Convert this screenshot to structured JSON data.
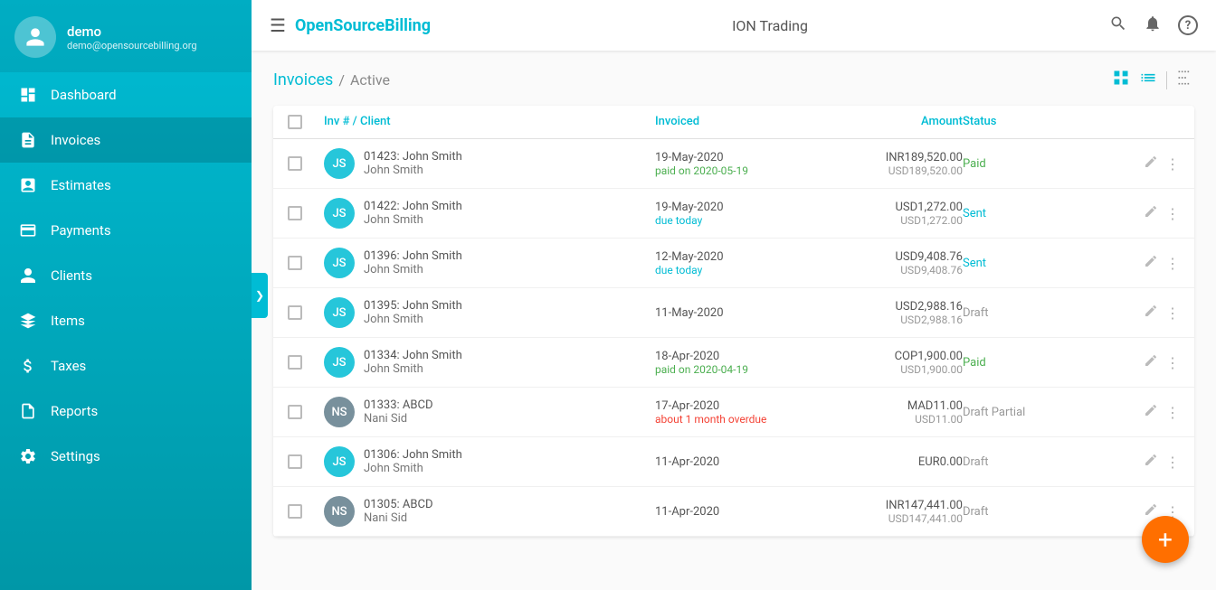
{
  "app": {
    "title": "ION Trading",
    "logo_prefix": "OpenSource",
    "logo_suffix": "Billing"
  },
  "topbar": {
    "hamburger_label": "☰",
    "search_label": "🔍",
    "bell_label": "🔔",
    "help_label": "?"
  },
  "sidebar": {
    "user": {
      "name": "demo",
      "email": "demo@opensourcebilling.org",
      "avatar_label": "👤"
    },
    "nav_items": [
      {
        "id": "dashboard",
        "label": "Dashboard",
        "icon": "⊞"
      },
      {
        "id": "invoices",
        "label": "Invoices",
        "icon": "≡",
        "active": true
      },
      {
        "id": "estimates",
        "label": "Estimates",
        "icon": "⊟"
      },
      {
        "id": "payments",
        "label": "Payments",
        "icon": "💲"
      },
      {
        "id": "clients",
        "label": "Clients",
        "icon": "👤"
      },
      {
        "id": "items",
        "label": "Items",
        "icon": "◈"
      },
      {
        "id": "taxes",
        "label": "Taxes",
        "icon": "＄"
      },
      {
        "id": "reports",
        "label": "Reports",
        "icon": "📄"
      },
      {
        "id": "settings",
        "label": "Settings",
        "icon": "⚙"
      }
    ]
  },
  "page": {
    "title": "Invoices",
    "breadcrumb": "Active"
  },
  "table": {
    "columns": [
      {
        "id": "checkbox",
        "label": ""
      },
      {
        "id": "inv_client",
        "label": "Inv # / Client"
      },
      {
        "id": "invoiced",
        "label": "Invoiced"
      },
      {
        "id": "amount",
        "label": "Amount"
      },
      {
        "id": "status",
        "label": "Status"
      },
      {
        "id": "actions",
        "label": ""
      }
    ],
    "rows": [
      {
        "avatar_initials": "JS",
        "avatar_class": "avatar-js",
        "inv_number": "01423: John Smith",
        "client_name": "John Smith",
        "date_primary": "19-May-2020",
        "date_secondary": "paid on 2020-05-19",
        "date_secondary_class": "text-green",
        "amount_primary": "INR189,520.00",
        "amount_secondary": "USD189,520.00",
        "status": "Paid",
        "status_class": "status-paid"
      },
      {
        "avatar_initials": "JS",
        "avatar_class": "avatar-js",
        "inv_number": "01422: John Smith",
        "client_name": "John Smith",
        "date_primary": "19-May-2020",
        "date_secondary": "due today",
        "date_secondary_class": "text-cyan",
        "amount_primary": "USD1,272.00",
        "amount_secondary": "USD1,272.00",
        "status": "Sent",
        "status_class": "status-sent"
      },
      {
        "avatar_initials": "JS",
        "avatar_class": "avatar-js",
        "inv_number": "01396: John Smith",
        "client_name": "John Smith",
        "date_primary": "12-May-2020",
        "date_secondary": "due today",
        "date_secondary_class": "text-cyan",
        "amount_primary": "USD9,408.76",
        "amount_secondary": "USD9,408.76",
        "status": "Sent",
        "status_class": "status-sent"
      },
      {
        "avatar_initials": "JS",
        "avatar_class": "avatar-js",
        "inv_number": "01395: John Smith",
        "client_name": "John Smith",
        "date_primary": "11-May-2020",
        "date_secondary": "",
        "date_secondary_class": "",
        "amount_primary": "USD2,988.16",
        "amount_secondary": "USD2,988.16",
        "status": "Draft",
        "status_class": "status-draft"
      },
      {
        "avatar_initials": "JS",
        "avatar_class": "avatar-js",
        "inv_number": "01334: John Smith",
        "client_name": "John Smith",
        "date_primary": "18-Apr-2020",
        "date_secondary": "paid on 2020-04-19",
        "date_secondary_class": "text-green",
        "amount_primary": "COP1,900.00",
        "amount_secondary": "USD1,900.00",
        "status": "Paid",
        "status_class": "status-paid"
      },
      {
        "avatar_initials": "NS",
        "avatar_class": "avatar-ns",
        "inv_number": "01333: ABCD",
        "client_name": "Nani Sid",
        "date_primary": "17-Apr-2020",
        "date_secondary": "about 1 month overdue",
        "date_secondary_class": "text-red",
        "amount_primary": "MAD11.00",
        "amount_secondary": "USD11.00",
        "status": "Draft Partial",
        "status_class": "status-draft-partial"
      },
      {
        "avatar_initials": "JS",
        "avatar_class": "avatar-js",
        "inv_number": "01306: John Smith",
        "client_name": "John Smith",
        "date_primary": "11-Apr-2020",
        "date_secondary": "",
        "date_secondary_class": "",
        "amount_primary": "EUR0.00",
        "amount_secondary": "",
        "status": "Draft",
        "status_class": "status-draft"
      },
      {
        "avatar_initials": "NS",
        "avatar_class": "avatar-ns",
        "inv_number": "01305: ABCD",
        "client_name": "Nani Sid",
        "date_primary": "11-Apr-2020",
        "date_secondary": "",
        "date_secondary_class": "",
        "amount_primary": "INR147,441.00",
        "amount_secondary": "USD147,441.00",
        "status": "Draft",
        "status_class": "status-draft"
      }
    ]
  },
  "fab": {
    "label": "+"
  },
  "collapse_tab": {
    "label": "❯"
  }
}
